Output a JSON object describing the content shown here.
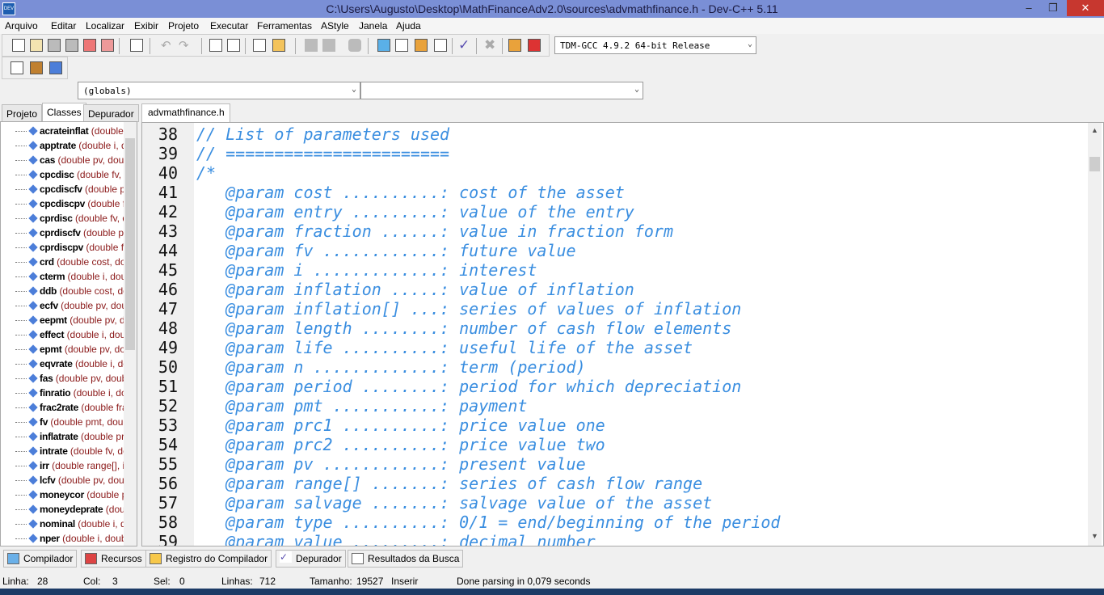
{
  "window": {
    "title": "C:\\Users\\Augusto\\Desktop\\MathFinanceAdv2.0\\sources\\advmathfinance.h - Dev-C++ 5.11",
    "minimize": "–",
    "restore": "❐",
    "close": "✕",
    "app_icon_text": "DEV"
  },
  "menu": [
    "Arquivo",
    "Editar",
    "Localizar",
    "Exibir",
    "Projeto",
    "Executar",
    "Ferramentas",
    "AStyle",
    "Janela",
    "Ajuda"
  ],
  "toolbar": {
    "compiler_select": "TDM-GCC 4.9.2 64-bit Release"
  },
  "class_bar": {
    "scope_select": "(globals)",
    "member_select": ""
  },
  "left_tabs": [
    "Projeto",
    "Classes",
    "Depurador"
  ],
  "left_active_tab": "Classes",
  "classes": [
    {
      "name": "acrateinflat",
      "sig": "(double"
    },
    {
      "name": "apptrate",
      "sig": "(double i, d"
    },
    {
      "name": "cas",
      "sig": "(double pv, doubl"
    },
    {
      "name": "cpcdisc",
      "sig": "(double fv, d"
    },
    {
      "name": "cpcdiscfv",
      "sig": "(double pv"
    },
    {
      "name": "cpcdiscpv",
      "sig": "(double fv"
    },
    {
      "name": "cprdisc",
      "sig": "(double fv, d"
    },
    {
      "name": "cprdiscfv",
      "sig": "(double pv"
    },
    {
      "name": "cprdiscpv",
      "sig": "(double fv"
    },
    {
      "name": "crd",
      "sig": "(double cost, dou"
    },
    {
      "name": "cterm",
      "sig": "(double i, doul"
    },
    {
      "name": "ddb",
      "sig": "(double cost, dou"
    },
    {
      "name": "ecfv",
      "sig": "(double pv, dou"
    },
    {
      "name": "eepmt",
      "sig": "(double pv, d"
    },
    {
      "name": "effect",
      "sig": "(double i, dou"
    },
    {
      "name": "epmt",
      "sig": "(double pv, dou"
    },
    {
      "name": "eqvrate",
      "sig": "(double i, dc"
    },
    {
      "name": "fas",
      "sig": "(double pv, doubl"
    },
    {
      "name": "finratio",
      "sig": "(double i, do"
    },
    {
      "name": "frac2rate",
      "sig": "(double fra"
    },
    {
      "name": "fv",
      "sig": "(double pmt, doubl"
    },
    {
      "name": "inflatrate",
      "sig": "(double pr"
    },
    {
      "name": "intrate",
      "sig": "(double fv, de"
    },
    {
      "name": "irr",
      "sig": "(double range[], in"
    },
    {
      "name": "lcfv",
      "sig": "(double pv, doub"
    },
    {
      "name": "moneycor",
      "sig": "(double p"
    },
    {
      "name": "moneydeprate",
      "sig": "(dou"
    },
    {
      "name": "nominal",
      "sig": "(double i, dc"
    },
    {
      "name": "nper",
      "sig": "(double i, doubl"
    }
  ],
  "editor_tab": "advmathfinance.h",
  "code_lines": [
    {
      "n": "38",
      "text": "// List of parameters used"
    },
    {
      "n": "39",
      "text": "// ======================="
    },
    {
      "n": "40",
      "text": "/*"
    },
    {
      "n": "41",
      "text": "   @param cost ..........: cost of the asset"
    },
    {
      "n": "42",
      "text": "   @param entry .........: value of the entry"
    },
    {
      "n": "43",
      "text": "   @param fraction ......: value in fraction form"
    },
    {
      "n": "44",
      "text": "   @param fv ............: future value"
    },
    {
      "n": "45",
      "text": "   @param i .............: interest"
    },
    {
      "n": "46",
      "text": "   @param inflation .....: value of inflation"
    },
    {
      "n": "47",
      "text": "   @param inflation[] ...: series of values of inflation"
    },
    {
      "n": "48",
      "text": "   @param length ........: number of cash flow elements"
    },
    {
      "n": "49",
      "text": "   @param life ..........: useful life of the asset"
    },
    {
      "n": "50",
      "text": "   @param n .............: term (period)"
    },
    {
      "n": "51",
      "text": "   @param period ........: period for which depreciation"
    },
    {
      "n": "52",
      "text": "   @param pmt ...........: payment"
    },
    {
      "n": "53",
      "text": "   @param prc1 ..........: price value one"
    },
    {
      "n": "54",
      "text": "   @param prc2 ..........: price value two"
    },
    {
      "n": "55",
      "text": "   @param pv ............: present value"
    },
    {
      "n": "56",
      "text": "   @param range[] .......: series of cash flow range"
    },
    {
      "n": "57",
      "text": "   @param salvage .......: salvage value of the asset"
    },
    {
      "n": "58",
      "text": "   @param type ..........: 0/1 = end/beginning of the period"
    },
    {
      "n": "59",
      "text": "   @param value .........: decimal number"
    }
  ],
  "bottom_tabs": [
    "Compilador",
    "Recursos",
    "Registro do Compilador",
    "Depurador",
    "Resultados da Busca"
  ],
  "status": {
    "linha_label": "Linha:",
    "linha": "28",
    "col_label": "Col:",
    "col": "3",
    "sel_label": "Sel:",
    "sel": "0",
    "linhas_label": "Linhas:",
    "linhas": "712",
    "tamanho_label": "Tamanho:",
    "tamanho": "19527",
    "mode": "Inserir",
    "message": "Done parsing in 0,079 seconds"
  },
  "colors": {
    "comment": "#3a8ee0",
    "signature": "#8b1a1a",
    "title_bar": "#7a8fd6"
  }
}
